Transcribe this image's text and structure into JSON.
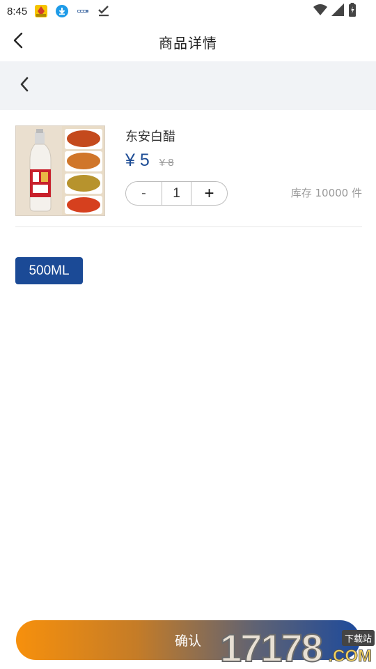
{
  "status_bar": {
    "time": "8:45",
    "icons": [
      "app-badge-icon",
      "download-icon",
      "app-label-icon",
      "checkmark-icon"
    ],
    "right_icons": [
      "wifi-icon",
      "signal-icon",
      "battery-icon"
    ]
  },
  "header": {
    "title": "商品详情",
    "back_icon": "chevron-left-icon"
  },
  "subbar": {
    "back_icon": "chevron-left-icon"
  },
  "product": {
    "name": "东安白醋",
    "price_current": "¥ 5",
    "price_original": "¥ 8",
    "quantity": "1",
    "minus_label": "-",
    "plus_label": "+",
    "stock": "库存 10000 件"
  },
  "spec": {
    "option": "500ML"
  },
  "confirm": {
    "label": "确认"
  },
  "watermark": {
    "number": "17178",
    "domain": ".COM",
    "badge": "下载站"
  },
  "colors": {
    "accent_blue": "#1b4a96",
    "price_blue": "#1f4e96",
    "confirm_start": "#f7900c",
    "confirm_end": "#1d4a9c",
    "subbar_bg": "#f1f3f6"
  }
}
